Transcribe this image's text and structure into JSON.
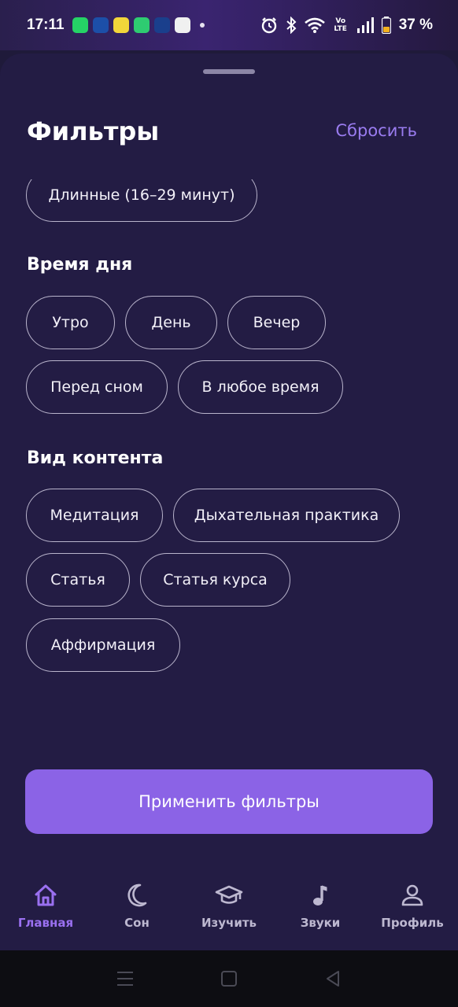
{
  "status_bar": {
    "time": "17:11",
    "battery": "37 %",
    "network": "Vo LTE"
  },
  "sheet": {
    "title": "Фильтры",
    "reset_label": "Сбросить"
  },
  "duration": {
    "visible_chip": "Длинные (16–29 минут)"
  },
  "time_of_day": {
    "title": "Время дня",
    "options": [
      "Утро",
      "День",
      "Вечер",
      "Перед сном",
      "В любое время"
    ]
  },
  "content_type": {
    "title": "Вид контента",
    "options": [
      "Медитация",
      "Дыхательная практика",
      "Статья",
      "Статья курса",
      "Аффирмация"
    ]
  },
  "apply_label": "Применить фильтры",
  "tabs": [
    {
      "label": "Главная",
      "icon": "home-icon",
      "active": true
    },
    {
      "label": "Сон",
      "icon": "moon-icon",
      "active": false
    },
    {
      "label": "Изучить",
      "icon": "graduation-cap-icon",
      "active": false
    },
    {
      "label": "Звуки",
      "icon": "music-note-icon",
      "active": false
    },
    {
      "label": "Профиль",
      "icon": "user-icon",
      "active": false
    }
  ],
  "colors": {
    "accent": "#8b63e6",
    "background": "#231c44",
    "active_tab": "#9a70f0"
  }
}
